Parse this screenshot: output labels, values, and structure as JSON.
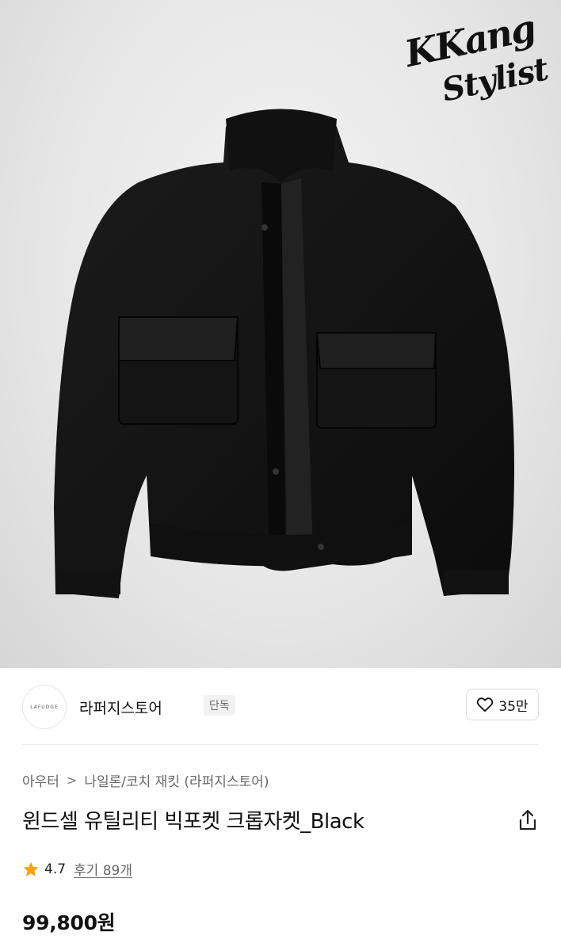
{
  "hero": {
    "watermark_line1": "KKang",
    "watermark_line2": "Stylist"
  },
  "store": {
    "logo_text": "LAFUDGE",
    "name": "라퍼지스토어",
    "badge": "단독",
    "like_count": "35만"
  },
  "breadcrumb": {
    "level1": "아우터",
    "separator": ">",
    "level2": "나일론/코치 재킷 (라퍼지스토어)"
  },
  "product": {
    "title": "윈드셀 유틸리티 빅포켓 크롭자켓_Black",
    "rating": "4.7",
    "review_label": "후기 89개",
    "price": "99,800원"
  },
  "colors": {
    "star": "#F6A312",
    "text": "#111111",
    "muted": "#666666",
    "jacket": "#161616"
  },
  "icons": [
    "heart-icon",
    "share-icon",
    "star-icon",
    "chevron-right-icon"
  ]
}
